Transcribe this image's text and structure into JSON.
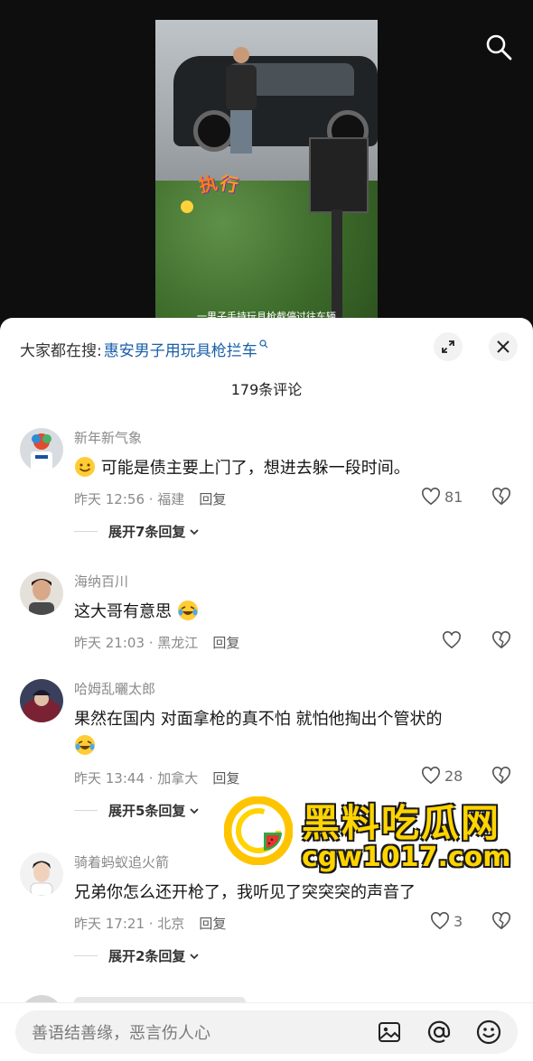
{
  "video": {
    "subtitle": "一男子手持玩具枪截停过往车辆",
    "stamp_1": "执",
    "stamp_2": "行"
  },
  "search": {
    "prefix": "大家都在搜:",
    "term": "惠安男子用玩具枪拦车"
  },
  "comment_count": "179条评论",
  "comments": [
    {
      "user": "新年新气象",
      "text": "可能是债主要上门了，想进去躲一段时间。",
      "time_location": "昨天 12:56 · 福建",
      "reply_label": "回复",
      "likes": "81",
      "expand_label": "展开7条回复"
    },
    {
      "user": "海纳百川",
      "text": "这大哥有意思",
      "time_location": "昨天 21:03 · 黑龙江",
      "reply_label": "回复",
      "likes": ""
    },
    {
      "user": "哈姆乱曬太郎",
      "text": "果然在国内 对面拿枪的真不怕 就怕他掏出个管状的",
      "time_location": "昨天 13:44 · 加拿大",
      "reply_label": "回复",
      "likes": "28",
      "expand_label": "展开5条回复"
    },
    {
      "user": "骑着蚂蚁追火箭",
      "text": "兄弟你怎么还开枪了，我听见了突突突的声音了",
      "time_location": "昨天 17:21 · 北京",
      "reply_label": "回复",
      "likes": "3",
      "expand_label": "展开2条回复"
    }
  ],
  "watermark": {
    "title": "黑料吃瓜网",
    "url": "cgw1017.com"
  },
  "input": {
    "placeholder": "善语结善缘，恶言伤人心"
  },
  "icons": [
    "search-icon",
    "expand-icon",
    "close-icon",
    "heart-icon",
    "broken-heart-icon",
    "chevron-down-icon",
    "image-icon",
    "at-icon",
    "emoji-icon"
  ],
  "colors": {
    "link": "#1a5fa8",
    "watermark": "#ffd400"
  }
}
